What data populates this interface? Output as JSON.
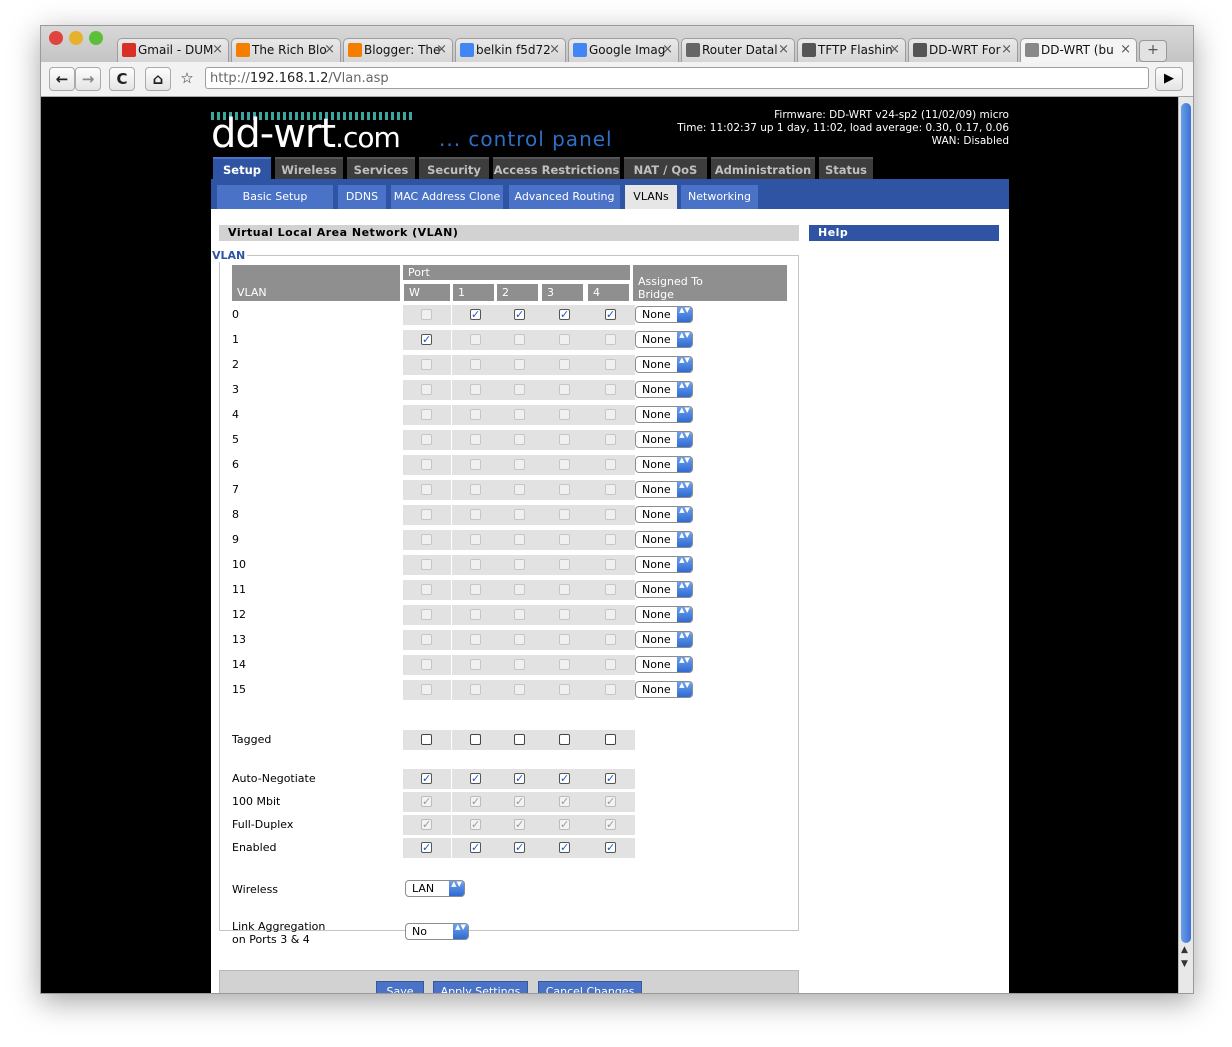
{
  "browser": {
    "tabs": [
      {
        "label": "Gmail - DUM",
        "icon": "gmail-icon",
        "color": "#d93025"
      },
      {
        "label": "The Rich Blo",
        "icon": "blogger-icon",
        "color": "#f57d00"
      },
      {
        "label": "Blogger: The",
        "icon": "blogger-icon",
        "color": "#f57d00"
      },
      {
        "label": "belkin f5d72",
        "icon": "google-icon",
        "color": "#4285f4"
      },
      {
        "label": "Google Imag",
        "icon": "google-icon",
        "color": "#4285f4"
      },
      {
        "label": "Router Datal",
        "icon": "router-icon",
        "color": "#666666"
      },
      {
        "label": "TFTP Flashin",
        "icon": "ddwrt-icon",
        "color": "#555555"
      },
      {
        "label": "DD-WRT For",
        "icon": "ddwrt-icon",
        "color": "#555555"
      },
      {
        "label": "DD-WRT (bu",
        "icon": "page-icon",
        "color": "#888888"
      }
    ],
    "active_tab": 8,
    "new_tab": "+",
    "url_prefix": "http://",
    "url_host": "192.168.1.2",
    "url_path": "/Vlan.asp",
    "back": "←",
    "forward": "→",
    "reload": "C",
    "home": "⌂",
    "star": "☆",
    "go": "▶"
  },
  "header": {
    "logo_main": "dd-wrt",
    "logo_com": ".com",
    "control_panel": "... control panel",
    "firmware": "Firmware: DD-WRT v24-sp2 (11/02/09) micro",
    "time": "Time: 11:02:37 up 1 day, 11:02, load average: 0.30, 0.17, 0.06",
    "wan": "WAN: Disabled"
  },
  "main_tabs": [
    "Setup",
    "Wireless",
    "Services",
    "Security",
    "Access Restrictions",
    "NAT / QoS",
    "Administration",
    "Status"
  ],
  "main_active": 0,
  "sub_tabs": [
    "Basic Setup",
    "DDNS",
    "MAC Address Clone",
    "Advanced Routing",
    "VLANs",
    "Networking"
  ],
  "sub_active": 4,
  "section_title": "Virtual Local Area Network (VLAN)",
  "help_title": "Help",
  "legend": "VLAN",
  "table": {
    "col_vlan": "VLAN",
    "col_port": "Port",
    "ports": [
      "W",
      "1",
      "2",
      "3",
      "4"
    ],
    "col_bridge_1": "Assigned To",
    "col_bridge_2": "Bridge",
    "rows": [
      {
        "label": "0",
        "ports": [
          0,
          1,
          1,
          1,
          1
        ],
        "bridge": "None"
      },
      {
        "label": "1",
        "ports": [
          1,
          0,
          0,
          0,
          0
        ],
        "bridge": "None"
      },
      {
        "label": "2",
        "ports": [
          0,
          0,
          0,
          0,
          0
        ],
        "bridge": "None"
      },
      {
        "label": "3",
        "ports": [
          0,
          0,
          0,
          0,
          0
        ],
        "bridge": "None"
      },
      {
        "label": "4",
        "ports": [
          0,
          0,
          0,
          0,
          0
        ],
        "bridge": "None"
      },
      {
        "label": "5",
        "ports": [
          0,
          0,
          0,
          0,
          0
        ],
        "bridge": "None"
      },
      {
        "label": "6",
        "ports": [
          0,
          0,
          0,
          0,
          0
        ],
        "bridge": "None"
      },
      {
        "label": "7",
        "ports": [
          0,
          0,
          0,
          0,
          0
        ],
        "bridge": "None"
      },
      {
        "label": "8",
        "ports": [
          0,
          0,
          0,
          0,
          0
        ],
        "bridge": "None"
      },
      {
        "label": "9",
        "ports": [
          0,
          0,
          0,
          0,
          0
        ],
        "bridge": "None"
      },
      {
        "label": "10",
        "ports": [
          0,
          0,
          0,
          0,
          0
        ],
        "bridge": "None"
      },
      {
        "label": "11",
        "ports": [
          0,
          0,
          0,
          0,
          0
        ],
        "bridge": "None"
      },
      {
        "label": "12",
        "ports": [
          0,
          0,
          0,
          0,
          0
        ],
        "bridge": "None"
      },
      {
        "label": "13",
        "ports": [
          0,
          0,
          0,
          0,
          0
        ],
        "bridge": "None"
      },
      {
        "label": "14",
        "ports": [
          0,
          0,
          0,
          0,
          0
        ],
        "bridge": "None"
      },
      {
        "label": "15",
        "ports": [
          0,
          0,
          0,
          0,
          0
        ],
        "bridge": "None"
      }
    ],
    "tagged": {
      "label": "Tagged",
      "ports": [
        0,
        0,
        0,
        0,
        0
      ]
    },
    "options": [
      {
        "label": "Auto-Negotiate",
        "ports": [
          1,
          1,
          1,
          1,
          1
        ],
        "enabled": true
      },
      {
        "label": "100 Mbit",
        "ports": [
          1,
          1,
          1,
          1,
          1
        ],
        "enabled": false
      },
      {
        "label": "Full-Duplex",
        "ports": [
          1,
          1,
          1,
          1,
          1
        ],
        "enabled": false
      },
      {
        "label": "Enabled",
        "ports": [
          1,
          1,
          1,
          1,
          1
        ],
        "enabled": true
      }
    ]
  },
  "wireless": {
    "label": "Wireless",
    "value": "LAN"
  },
  "link_agg": {
    "label_1": "Link Aggregation",
    "label_2": "on Ports 3 & 4",
    "value": "No"
  },
  "buttons": {
    "save": "Save",
    "apply": "Apply Settings",
    "cancel": "Cancel Changes"
  },
  "check_mark": "✓",
  "select_arrows": "▲▼"
}
